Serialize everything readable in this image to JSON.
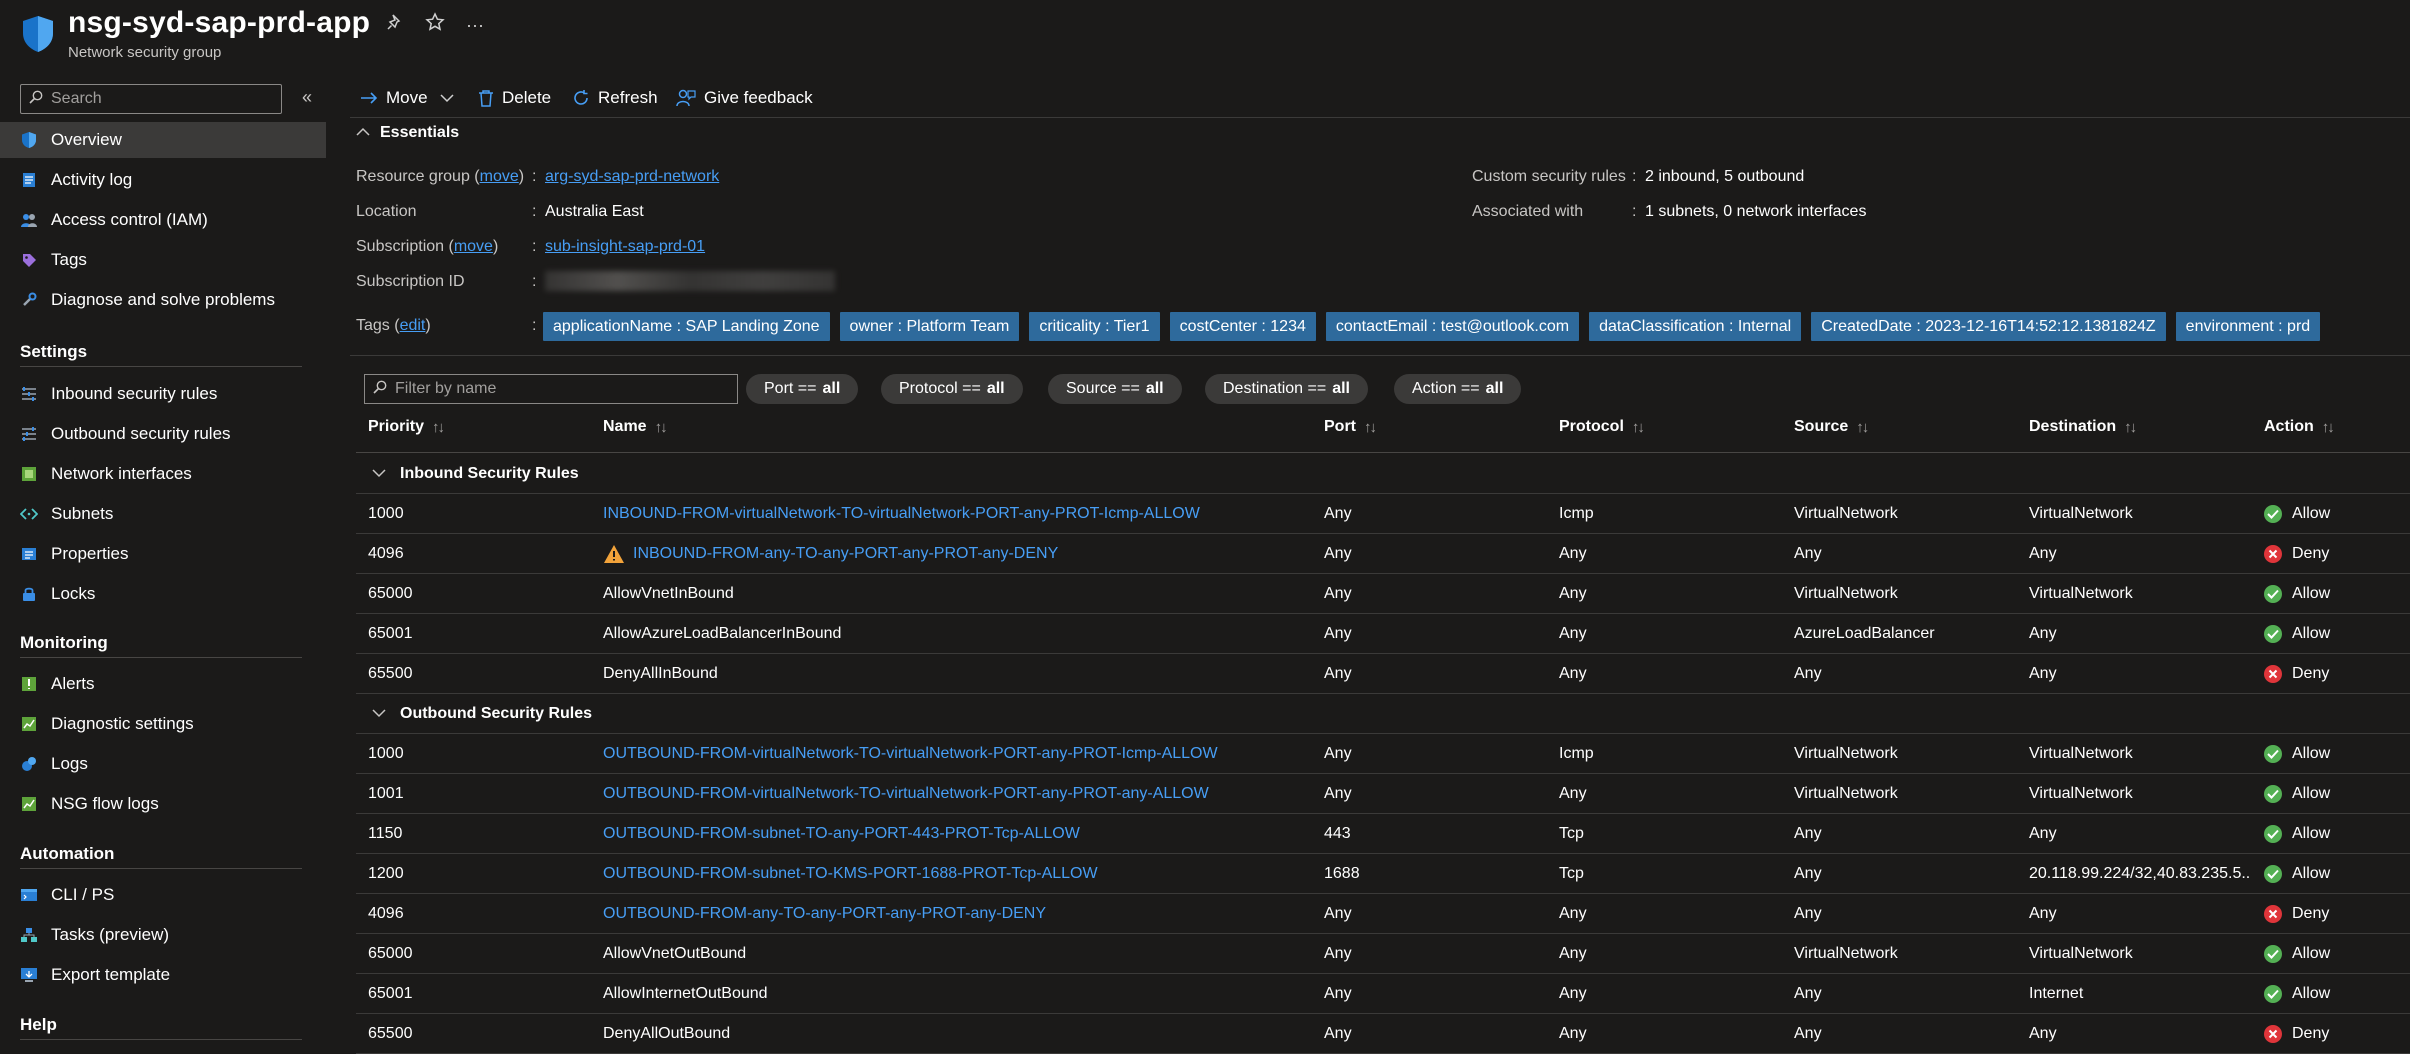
{
  "resource": {
    "title": "nsg-syd-sap-prd-app",
    "subtitle": "Network security group"
  },
  "nav": {
    "search_placeholder": "Search",
    "top_items": [
      {
        "label": "Overview",
        "icon": "shield-icon",
        "active": true
      },
      {
        "label": "Activity log",
        "icon": "activity-log-icon"
      },
      {
        "label": "Access control (IAM)",
        "icon": "people-icon"
      },
      {
        "label": "Tags",
        "icon": "tag-icon"
      },
      {
        "label": "Diagnose and solve problems",
        "icon": "wrench-icon"
      }
    ],
    "sections": [
      {
        "title": "Settings",
        "items": [
          {
            "label": "Inbound security rules",
            "icon": "inbound-rules-icon"
          },
          {
            "label": "Outbound security rules",
            "icon": "outbound-rules-icon"
          },
          {
            "label": "Network interfaces",
            "icon": "network-interface-icon"
          },
          {
            "label": "Subnets",
            "icon": "subnet-icon"
          },
          {
            "label": "Properties",
            "icon": "properties-icon"
          },
          {
            "label": "Locks",
            "icon": "lock-icon"
          }
        ]
      },
      {
        "title": "Monitoring",
        "items": [
          {
            "label": "Alerts",
            "icon": "alert-icon"
          },
          {
            "label": "Diagnostic settings",
            "icon": "diagnostic-settings-icon"
          },
          {
            "label": "Logs",
            "icon": "logs-icon"
          },
          {
            "label": "NSG flow logs",
            "icon": "flow-logs-icon"
          }
        ]
      },
      {
        "title": "Automation",
        "items": [
          {
            "label": "CLI / PS",
            "icon": "cli-icon"
          },
          {
            "label": "Tasks (preview)",
            "icon": "tasks-icon"
          },
          {
            "label": "Export template",
            "icon": "export-template-icon"
          }
        ]
      },
      {
        "title": "Help",
        "items": []
      }
    ]
  },
  "toolbar": {
    "move": "Move",
    "delete": "Delete",
    "refresh": "Refresh",
    "feedback": "Give feedback"
  },
  "essentials": {
    "title": "Essentials",
    "resource_group_label": "Resource group",
    "move_link": "move",
    "resource_group_value": "arg-syd-sap-prd-network",
    "location_label": "Location",
    "location_value": "Australia East",
    "subscription_label": "Subscription",
    "subscription_value": "sub-insight-sap-prd-01",
    "subscription_id_label": "Subscription ID",
    "tags_label": "Tags",
    "edit_link": "edit",
    "custom_rules_label": "Custom security rules",
    "custom_rules_value": "2 inbound, 5 outbound",
    "associated_label": "Associated with",
    "associated_value": "1 subnets, 0 network interfaces",
    "tags": [
      "applicationName : SAP Landing Zone",
      "owner : Platform Team",
      "criticality : Tier1",
      "costCenter : 1234",
      "contactEmail : test@outlook.com",
      "dataClassification : Internal",
      "CreatedDate : 2023-12-16T14:52:12.1381824Z",
      "environment : prd"
    ]
  },
  "filters": {
    "placeholder": "Filter by name",
    "pills": [
      {
        "key": "Port ==",
        "value": "all"
      },
      {
        "key": "Protocol ==",
        "value": "all"
      },
      {
        "key": "Source ==",
        "value": "all"
      },
      {
        "key": "Destination ==",
        "value": "all"
      },
      {
        "key": "Action ==",
        "value": "all"
      }
    ]
  },
  "table": {
    "columns": [
      "Priority",
      "Name",
      "Port",
      "Protocol",
      "Source",
      "Destination",
      "Action"
    ],
    "groups": [
      {
        "title": "Inbound Security Rules",
        "rows": [
          {
            "priority": "1000",
            "name": "INBOUND-FROM-virtualNetwork-TO-virtualNetwork-PORT-any-PROT-Icmp-ALLOW",
            "link": true,
            "warning": false,
            "port": "Any",
            "protocol": "Icmp",
            "source": "VirtualNetwork",
            "destination": "VirtualNetwork",
            "action": "Allow"
          },
          {
            "priority": "4096",
            "name": "INBOUND-FROM-any-TO-any-PORT-any-PROT-any-DENY",
            "link": true,
            "warning": true,
            "port": "Any",
            "protocol": "Any",
            "source": "Any",
            "destination": "Any",
            "action": "Deny"
          },
          {
            "priority": "65000",
            "name": "AllowVnetInBound",
            "link": false,
            "warning": false,
            "port": "Any",
            "protocol": "Any",
            "source": "VirtualNetwork",
            "destination": "VirtualNetwork",
            "action": "Allow"
          },
          {
            "priority": "65001",
            "name": "AllowAzureLoadBalancerInBound",
            "link": false,
            "warning": false,
            "port": "Any",
            "protocol": "Any",
            "source": "AzureLoadBalancer",
            "destination": "Any",
            "action": "Allow"
          },
          {
            "priority": "65500",
            "name": "DenyAllInBound",
            "link": false,
            "warning": false,
            "port": "Any",
            "protocol": "Any",
            "source": "Any",
            "destination": "Any",
            "action": "Deny"
          }
        ]
      },
      {
        "title": "Outbound Security Rules",
        "rows": [
          {
            "priority": "1000",
            "name": "OUTBOUND-FROM-virtualNetwork-TO-virtualNetwork-PORT-any-PROT-Icmp-ALLOW",
            "link": true,
            "warning": false,
            "port": "Any",
            "protocol": "Icmp",
            "source": "VirtualNetwork",
            "destination": "VirtualNetwork",
            "action": "Allow"
          },
          {
            "priority": "1001",
            "name": "OUTBOUND-FROM-virtualNetwork-TO-virtualNetwork-PORT-any-PROT-any-ALLOW",
            "link": true,
            "warning": false,
            "port": "Any",
            "protocol": "Any",
            "source": "VirtualNetwork",
            "destination": "VirtualNetwork",
            "action": "Allow"
          },
          {
            "priority": "1150",
            "name": "OUTBOUND-FROM-subnet-TO-any-PORT-443-PROT-Tcp-ALLOW",
            "link": true,
            "warning": false,
            "port": "443",
            "protocol": "Tcp",
            "source": "Any",
            "destination": "Any",
            "action": "Allow"
          },
          {
            "priority": "1200",
            "name": "OUTBOUND-FROM-subnet-TO-KMS-PORT-1688-PROT-Tcp-ALLOW",
            "link": true,
            "warning": false,
            "port": "1688",
            "protocol": "Tcp",
            "source": "Any",
            "destination": "20.118.99.224/32,40.83.235.5...",
            "action": "Allow"
          },
          {
            "priority": "4096",
            "name": "OUTBOUND-FROM-any-TO-any-PORT-any-PROT-any-DENY",
            "link": true,
            "warning": false,
            "port": "Any",
            "protocol": "Any",
            "source": "Any",
            "destination": "Any",
            "action": "Deny"
          },
          {
            "priority": "65000",
            "name": "AllowVnetOutBound",
            "link": false,
            "warning": false,
            "port": "Any",
            "protocol": "Any",
            "source": "VirtualNetwork",
            "destination": "VirtualNetwork",
            "action": "Allow"
          },
          {
            "priority": "65001",
            "name": "AllowInternetOutBound",
            "link": false,
            "warning": false,
            "port": "Any",
            "protocol": "Any",
            "source": "Any",
            "destination": "Internet",
            "action": "Allow"
          },
          {
            "priority": "65500",
            "name": "DenyAllOutBound",
            "link": false,
            "warning": false,
            "port": "Any",
            "protocol": "Any",
            "source": "Any",
            "destination": "Any",
            "action": "Deny"
          }
        ]
      }
    ]
  },
  "colors": {
    "background": "#1b1a19",
    "link": "#479ef5",
    "tag": "#2e6a9c",
    "allow": "#54b054",
    "deny": "#e0353a",
    "warning": "#f2a33a"
  }
}
